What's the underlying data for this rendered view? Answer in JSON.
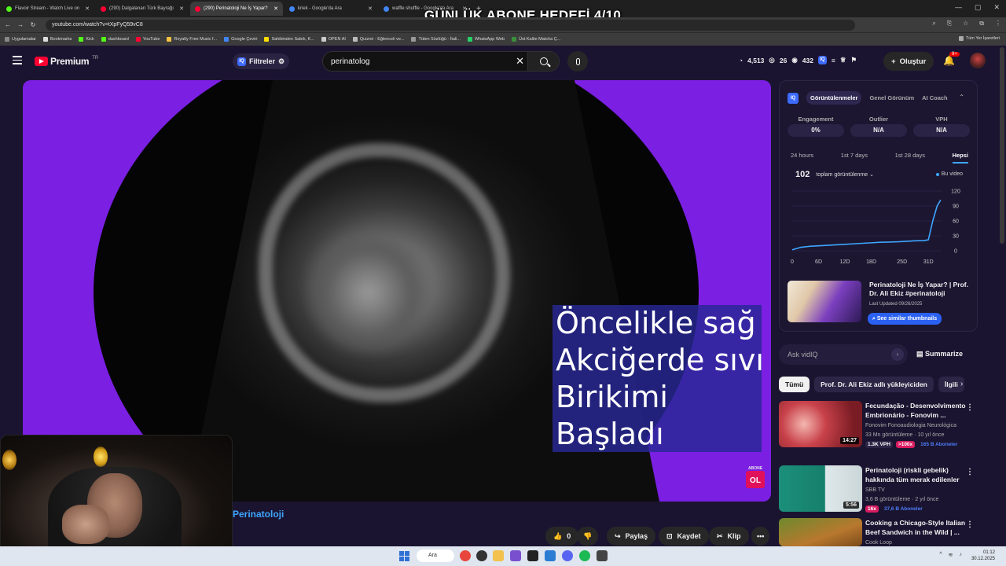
{
  "overlay_title": "GÜNLÜK ABONE HEDEFİ 4/10",
  "browser": {
    "tabs": [
      {
        "label": "Flavoir Stream - Watch Live on",
        "color": "#53fc18"
      },
      {
        "label": "(290) Dalgalanan Türk Bayrağı",
        "color": "#ff0033"
      },
      {
        "label": "(290) Perinatoloji Ne İş Yapar?",
        "color": "#ff0033",
        "active": true
      },
      {
        "label": "kriek - Google'da Ara",
        "color": "#4285f4"
      },
      {
        "label": "waffle shuffle - Google'da Ara",
        "color": "#4285f4"
      }
    ],
    "url": "youtube.com/watch?v=tXpFyQ59vC8",
    "bookmarks": [
      "Uygulamalar",
      "Bookmarks",
      "Kick",
      "dashboard",
      "YouTube",
      "Royalty Free Music f...",
      "Google Çeviri",
      "Sahibinden Sabık, K...",
      "OPEN AI",
      "Quizrei - Eğlenceli ve...",
      "Tüten Sözlüğü - İtali...",
      "WhatsApp Web",
      "Üst Kalite Matcha Ç..."
    ],
    "bookmarks_right": "Tüm Yer İşaretleri"
  },
  "masthead": {
    "logo_text": "Premium",
    "logo_sup": "TR",
    "filters_label": "Filtreler",
    "search_value": "perinatolog",
    "stats": {
      "views": "4,513",
      "likes": "26",
      "subs": "432"
    },
    "create_label": "Oluştur",
    "notif_badge": "9+"
  },
  "player": {
    "subtitle_lines": [
      "Öncelikle sağ",
      "Akciğerde sıvı",
      "Birikimi",
      "Başladı"
    ],
    "ol_badge": "OL",
    "ol_small": "ABONE"
  },
  "video_title": "Perinatoloji",
  "actions": {
    "like_count": "0",
    "share": "Paylaş",
    "save": "Kaydet",
    "clip": "Klip"
  },
  "vidiq": {
    "tabs": [
      "Görüntülenmeler",
      "Genel Görünüm",
      "AI Coach"
    ],
    "metrics": [
      {
        "label": "Engagement",
        "value": "0%"
      },
      {
        "label": "Outlier",
        "value": "N/A"
      },
      {
        "label": "VPH",
        "value": "N/A"
      }
    ],
    "periods": [
      "24 hours",
      "1st 7 days",
      "1st 28 days",
      "Hepsi"
    ],
    "total": "102",
    "total_label": "toplam görüntülenme",
    "legend": "Bu video",
    "thumb_title": "Perinatoloji Ne İş Yapar? | Prof. Dr. Ali Ekiz #perinatoloji",
    "thumb_date": "Last Updated 09/26/2025",
    "thumb_button": "See similar thumbnails"
  },
  "chart_data": {
    "type": "line",
    "x_ticks": [
      "0",
      "6D",
      "12D",
      "18D",
      "25D",
      "31D"
    ],
    "y_ticks": [
      "120",
      "90",
      "60",
      "30",
      "0"
    ],
    "ylim": [
      0,
      120
    ],
    "series": [
      {
        "name": "Bu video",
        "x": [
          0,
          2,
          4,
          6,
          8,
          10,
          12,
          14,
          16,
          18,
          20,
          22,
          24,
          26,
          28,
          30,
          31,
          32,
          33,
          33.8
        ],
        "y": [
          2,
          7,
          9,
          10,
          11,
          12,
          13,
          14,
          15,
          16,
          17,
          17.5,
          18,
          19,
          20,
          20.5,
          22,
          60,
          90,
          102
        ]
      }
    ]
  },
  "ask": {
    "placeholder": "Ask vidIQ",
    "summarize": "Summarize"
  },
  "chips": [
    "Tümü",
    "Prof. Dr. Ali Ekiz adlı yükleyiciden",
    "İlgili"
  ],
  "recommendations": [
    {
      "title": "Fecundação - Desenvolvimento Embrionário - Fonovim ...",
      "channel": "Fonovim Fonoaudiologia Neurológica",
      "meta": "33 Mn görüntüleme · 10 yıl önce",
      "duration": "14:27",
      "tags": [
        "1.3K VPH",
        ">100x",
        "165 B Aboneler"
      ],
      "colors": [
        "#c8414a",
        "#f4b7b0"
      ]
    },
    {
      "title": "Perinatoloji (riskli gebelik) hakkında tüm merak edilenler ...",
      "channel": "SBB TV",
      "meta": "3,6 B görüntüleme · 2 yıl önce",
      "duration": "5:56",
      "tags": [
        "16x",
        "37,6 B Aboneler"
      ],
      "colors": [
        "#1b8f7a",
        "#dfe8ea"
      ]
    },
    {
      "title": "Cooking a Chicago-Style Italian Beef Sandwich in the Wild | ...",
      "channel": "Cook Loop",
      "meta": "",
      "duration": "",
      "tags": [],
      "colors": [
        "#6d8a2d",
        "#b8782e"
      ]
    }
  ],
  "taskbar": {
    "search_label": "Ara",
    "time": "01:12",
    "date": "30.12.2025"
  }
}
